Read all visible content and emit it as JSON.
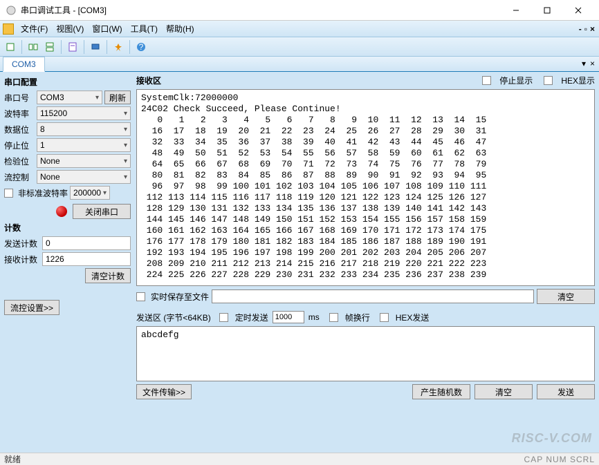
{
  "window": {
    "title": "串口调试工具 - [COM3]"
  },
  "menu": {
    "file": "文件(F)",
    "view": "视图(V)",
    "window": "窗口(W)",
    "tool": "工具(T)",
    "help": "帮助(H)"
  },
  "tabs": {
    "active": "COM3"
  },
  "left": {
    "config_title": "串口配置",
    "port_label": "串口号",
    "port_value": "COM3",
    "refresh": "刷新",
    "baud_label": "波特率",
    "baud_value": "115200",
    "databits_label": "数据位",
    "databits_value": "8",
    "stopbits_label": "停止位",
    "stopbits_value": "1",
    "parity_label": "检验位",
    "parity_value": "None",
    "flow_label": "流控制",
    "flow_value": "None",
    "nonstd_label": "非标准波特率",
    "nonstd_value": "200000",
    "close_port": "关闭串口",
    "count_title": "计数",
    "send_count_label": "发送计数",
    "send_count_value": "0",
    "recv_count_label": "接收计数",
    "recv_count_value": "1226",
    "clear_count": "清空计数",
    "flow_settings": "流控设置>>"
  },
  "recv": {
    "title": "接收区",
    "stop_display": "停止显示",
    "hex_display": "HEX显示",
    "text_header1": "SystemClk:72000000",
    "text_header2": "24C02 Check Succeed, Please Continue!",
    "realtime_save": "实时保存至文件",
    "clear": "清空"
  },
  "send": {
    "title": "发送区 (字节<64KB)",
    "timed_send": "定时发送",
    "timed_value": "1000",
    "timed_unit": "ms",
    "frame_wrap": "帧换行",
    "hex_send": "HEX发送",
    "text": "abcdefg",
    "file_transfer": "文件传输>>",
    "gen_random": "产生随机数",
    "clear": "清空",
    "send_btn": "发送"
  },
  "status": {
    "ready": "就绪",
    "indicators": "CAP NUM SCRL"
  },
  "watermark": "RISC-V.COM"
}
